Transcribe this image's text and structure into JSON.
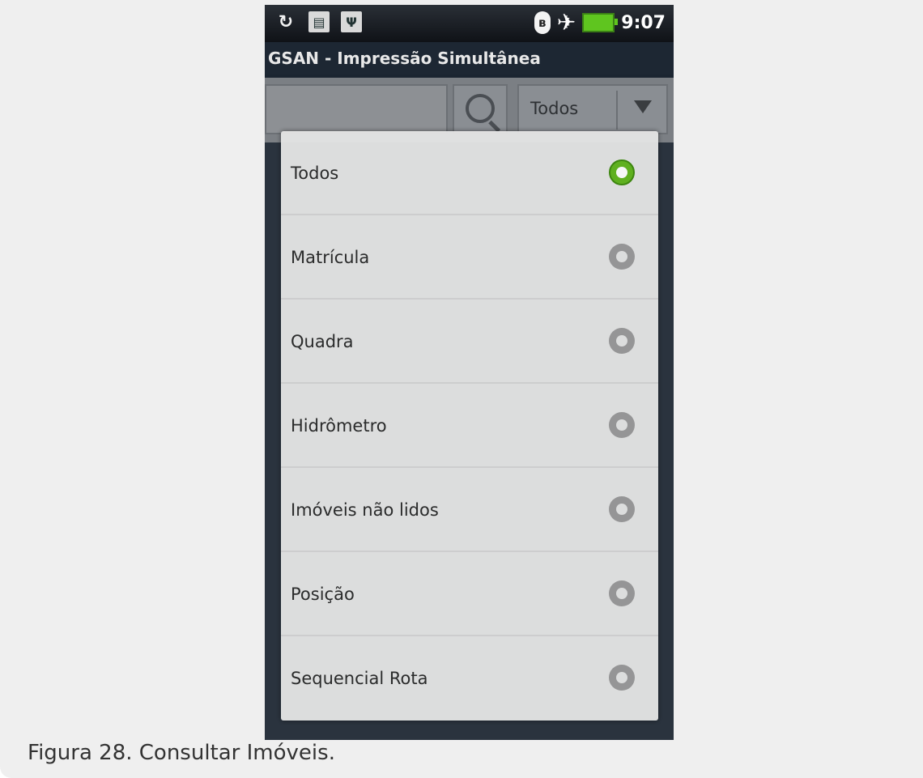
{
  "caption": "Figura 28. Consultar Imóveis.",
  "status_bar": {
    "icons_left": [
      "sync-icon",
      "sd-card-icon",
      "usb-icon"
    ],
    "icons_right": [
      "bluetooth-icon",
      "airplane-mode-icon",
      "battery-charging-icon"
    ],
    "time": "9:07"
  },
  "app": {
    "title": "GSAN - Impressão Simultânea"
  },
  "toolbar": {
    "search_value": "",
    "filter_selected": "Todos"
  },
  "dialog": {
    "options": [
      {
        "label": "Todos",
        "checked": true
      },
      {
        "label": "Matrícula",
        "checked": false
      },
      {
        "label": "Quadra",
        "checked": false
      },
      {
        "label": "Hidrômetro",
        "checked": false
      },
      {
        "label": "Imóveis não lidos",
        "checked": false
      },
      {
        "label": "Posição",
        "checked": false
      },
      {
        "label": "Sequencial Rota",
        "checked": false
      }
    ]
  },
  "colors": {
    "radio_checked": "#62b61e",
    "radio_unchecked": "#9a9a9a",
    "status_bar_bg": "#13171c",
    "dialog_bg": "#e4e4e4"
  }
}
